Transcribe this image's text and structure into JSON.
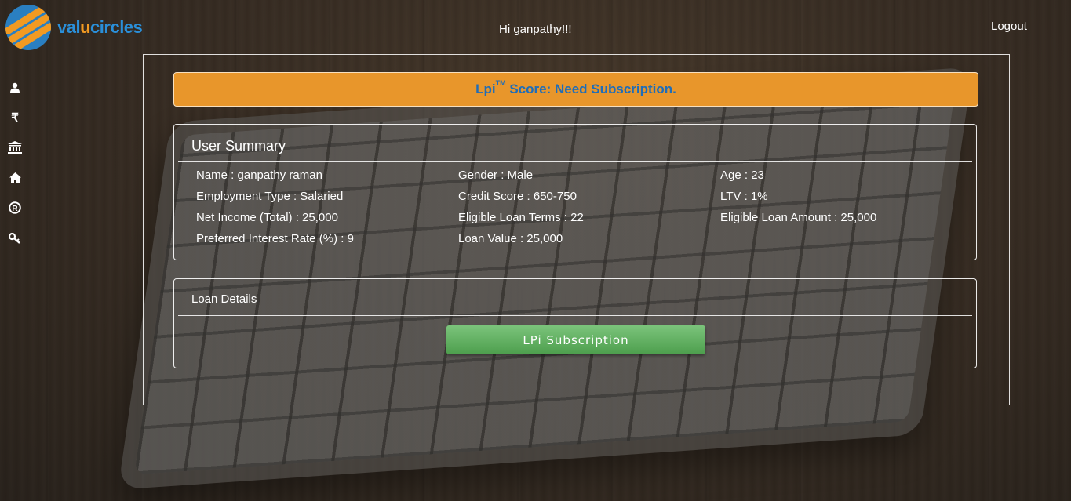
{
  "header": {
    "logo_prefix": "val",
    "logo_accent": "u",
    "logo_suffix": "circles",
    "greeting": "Hi ganpathy!!!",
    "logout_label": "Logout"
  },
  "sidebar": {
    "icons": [
      "user-icon",
      "rupee-icon",
      "bank-icon",
      "home-icon",
      "registered-icon",
      "key-icon"
    ]
  },
  "banner": {
    "score_prefix": "Lpi",
    "trademark": "TM",
    "score_text": " Score: Need Subscription."
  },
  "user_summary": {
    "title": "User Summary",
    "fields": [
      "Name : ganpathy raman",
      "Gender : Male",
      "Age : 23",
      "Employment Type : Salaried",
      "Credit Score : 650-750",
      "LTV : 1%",
      "Net Income (Total) : 25,000",
      "Eligible Loan Terms : 22",
      "Eligible Loan Amount : 25,000",
      "Preferred Interest Rate (%) : 9",
      "Loan Value : 25,000"
    ]
  },
  "loan_details": {
    "title": "Loan Details",
    "button_label": "LPi Subscription"
  },
  "colors": {
    "banner_bg": "#e8962b",
    "banner_text": "#1f6db8",
    "button_green": "#5cb85c",
    "logo_blue": "#2a8fd9",
    "logo_orange": "#f29a22"
  }
}
